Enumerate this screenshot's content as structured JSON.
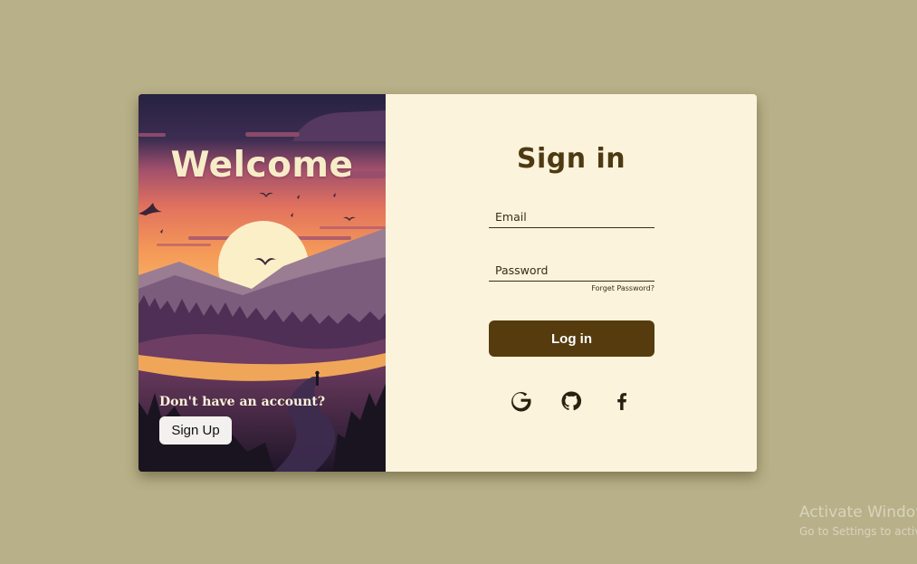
{
  "left_panel": {
    "welcome_text": "Welcome",
    "no_account_text": "Don't have an account?",
    "signup_label": "Sign Up"
  },
  "right_panel": {
    "title": "Sign in",
    "email_placeholder": "Email",
    "password_placeholder": "Password",
    "forgot_label": "Forget Password?",
    "login_label": "Log in",
    "socials": [
      "google-icon",
      "github-icon",
      "facebook-icon"
    ]
  },
  "watermark": {
    "title": "Activate Windows",
    "subtitle": "Go to Settings to activate Windows."
  },
  "colors": {
    "page_background": "#b8b088",
    "panel_background": "#fbf3dc",
    "accent_brown": "#553b0e",
    "title_brown": "#4e3a12"
  }
}
